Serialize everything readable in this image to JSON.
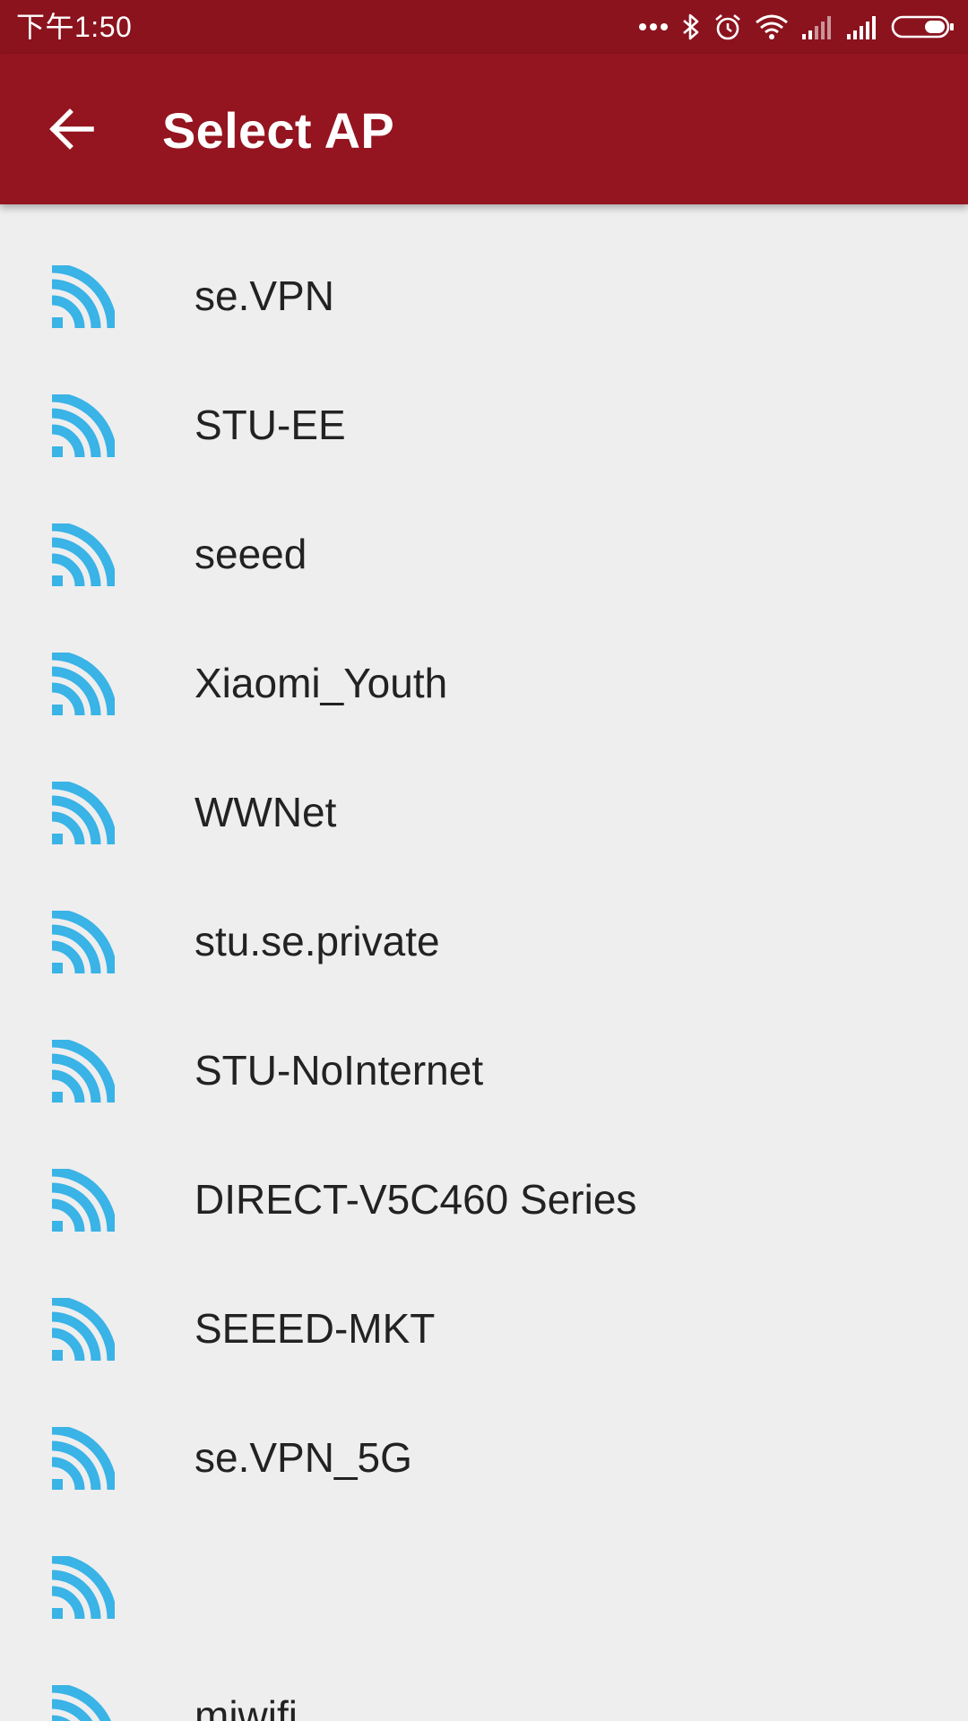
{
  "status_bar": {
    "time": "下午1:50",
    "icons": [
      "more-dots-icon",
      "bluetooth-icon",
      "alarm-icon",
      "wifi-status-icon",
      "signal-icon",
      "signal-icon",
      "battery-icon"
    ]
  },
  "app_bar": {
    "title": "Select AP",
    "back_icon": "arrow-left-icon",
    "background": "#94141f",
    "status_background": "#8b131e"
  },
  "ap_list": {
    "icon": "wifi-signal-icon",
    "icon_color": "#3ab3e6",
    "items": [
      {
        "name": "se.VPN"
      },
      {
        "name": "STU-EE"
      },
      {
        "name": "seeed"
      },
      {
        "name": "Xiaomi_Youth"
      },
      {
        "name": "WWNet"
      },
      {
        "name": "stu.se.private"
      },
      {
        "name": "STU-NoInternet"
      },
      {
        "name": "DIRECT-V5C460 Series"
      },
      {
        "name": "SEEED-MKT"
      },
      {
        "name": "se.VPN_5G"
      },
      {
        "name": ""
      },
      {
        "name": "miwifi"
      }
    ]
  }
}
